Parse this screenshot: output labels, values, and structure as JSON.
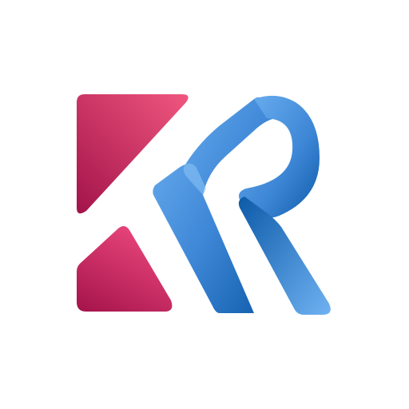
{
  "logo": {
    "colors": {
      "background": "#ffffff",
      "k_light": "#f0577f",
      "k_dark": "#a3134a",
      "r_light": "#6fb2f2",
      "r_mid": "#3d86d6",
      "r_dark": "#0d5aa8"
    },
    "parts": [
      "k-upper-shape",
      "k-lower-shape",
      "r-left-ribbon",
      "r-bowl-ribbon"
    ]
  }
}
